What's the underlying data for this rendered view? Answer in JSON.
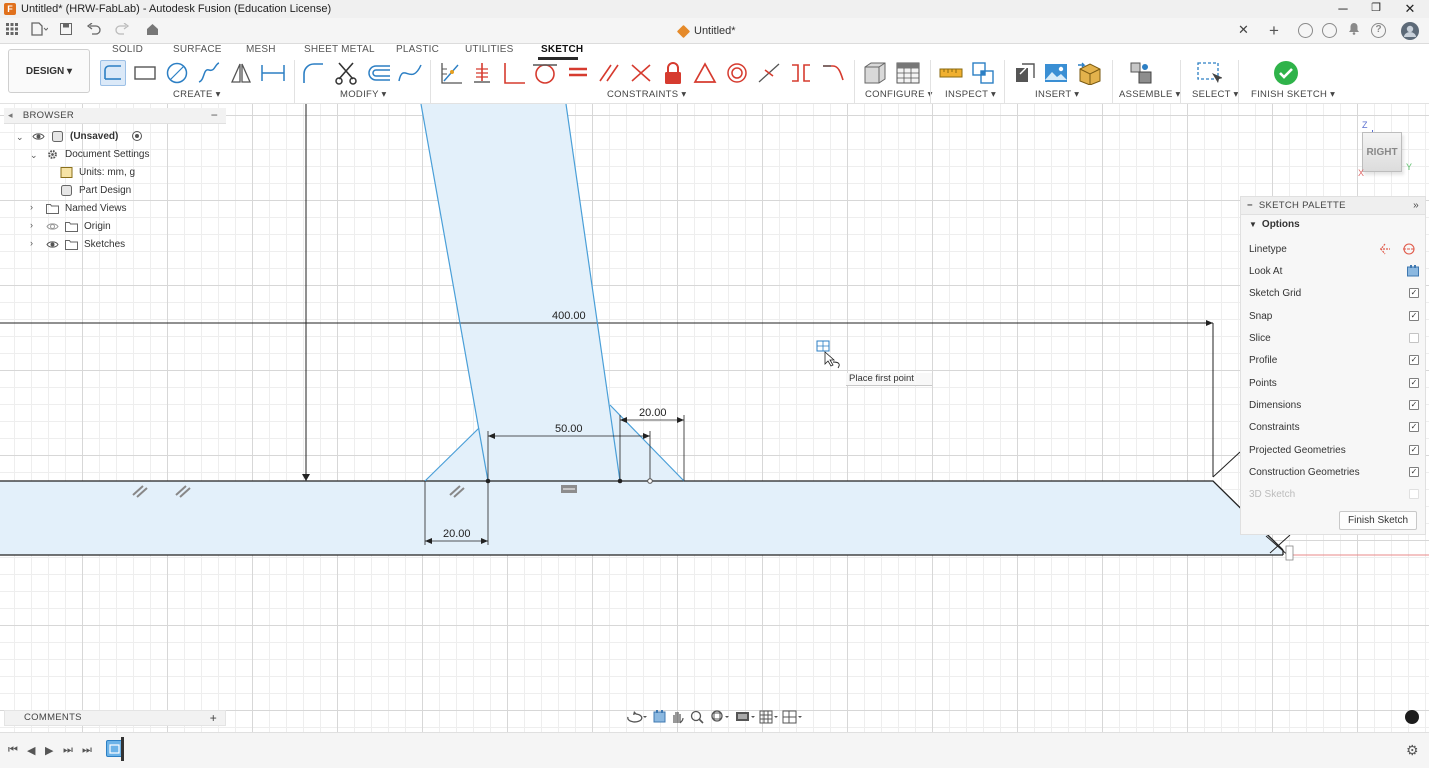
{
  "window": {
    "title": "Untitled* (HRW-FabLab) - Autodesk Fusion (Education License)",
    "minimize": "─",
    "maximize": "❐",
    "close": "✕"
  },
  "tabbar": {
    "document_tab": "Untitled*",
    "close": "✕",
    "add": "+"
  },
  "toolbar": {
    "workspace": "DESIGN ▾",
    "tabs": [
      "SOLID",
      "SURFACE",
      "MESH",
      "SHEET METAL",
      "PLASTIC",
      "UTILITIES",
      "SKETCH"
    ],
    "active_tab": "SKETCH",
    "groups": {
      "create": "CREATE ▾",
      "modify": "MODIFY ▾",
      "constraints": "CONSTRAINTS ▾",
      "configure": "CONFIGURE ▾",
      "inspect": "INSPECT ▾",
      "insert": "INSERT ▾",
      "assemble": "ASSEMBLE ▾",
      "select": "SELECT ▾",
      "finish": "FINISH SKETCH ▾"
    }
  },
  "browser": {
    "header": "BROWSER",
    "collapse": "−",
    "items": [
      {
        "label": "(Unsaved)"
      },
      {
        "label": "Document Settings"
      },
      {
        "label": "Units: mm, g"
      },
      {
        "label": "Part Design"
      },
      {
        "label": "Named Views"
      },
      {
        "label": "Origin"
      },
      {
        "label": "Sketches"
      }
    ]
  },
  "sketch": {
    "dimensions": [
      "400.00",
      "50.00",
      "20.00",
      "20.00"
    ],
    "tooltip": "Place first point"
  },
  "viewcube": {
    "face": "RIGHT",
    "axis_z": "Z",
    "axis_y": "Y",
    "axis_x": "X"
  },
  "palette": {
    "header": "SKETCH PALETTE",
    "section": "Options",
    "rows": [
      {
        "label": "Linetype",
        "type": "icons"
      },
      {
        "label": "Look At",
        "type": "icon"
      },
      {
        "label": "Sketch Grid",
        "checked": true
      },
      {
        "label": "Snap",
        "checked": true
      },
      {
        "label": "Slice",
        "checked": false
      },
      {
        "label": "Profile",
        "checked": true
      },
      {
        "label": "Points",
        "checked": true
      },
      {
        "label": "Dimensions",
        "checked": true
      },
      {
        "label": "Constraints",
        "checked": true
      },
      {
        "label": "Projected Geometries",
        "checked": true
      },
      {
        "label": "Construction Geometries",
        "checked": true
      },
      {
        "label": "3D Sketch",
        "checked": false,
        "disabled": true
      }
    ],
    "finish_button": "Finish Sketch"
  },
  "comments": {
    "header": "COMMENTS",
    "add": "+"
  },
  "colors": {
    "accent_blue": "#4a9fd8",
    "profile_fill": "#e3f0fa",
    "finish_green": "#2fb34a",
    "constraint_red": "#d63b2f"
  }
}
